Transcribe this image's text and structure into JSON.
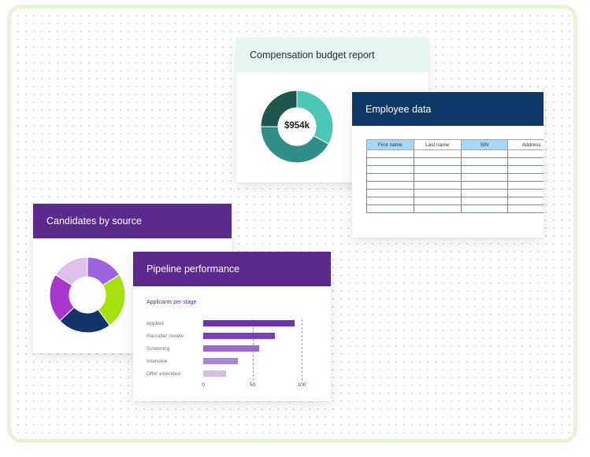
{
  "compensation_card": {
    "title": "Compensation budget report",
    "donut_center": "$954k",
    "segments": [
      {
        "fraction": 0.33,
        "color": "#4cc7b6"
      },
      {
        "fraction": 0.42,
        "color": "#2f8f86"
      },
      {
        "fraction": 0.25,
        "color": "#1f564f"
      }
    ]
  },
  "employee_card": {
    "title": "Employee data",
    "columns": [
      {
        "label": "First name",
        "highlight": true
      },
      {
        "label": "Last name",
        "highlight": false
      },
      {
        "label": "SIN",
        "highlight": true
      },
      {
        "label": "Address",
        "highlight": false
      }
    ],
    "empty_rows": 8
  },
  "candidates_card": {
    "title": "Candidates by source",
    "segments": [
      {
        "fraction": 0.16,
        "color": "#9d62df"
      },
      {
        "fraction": 0.24,
        "color": "#a6e10e"
      },
      {
        "fraction": 0.23,
        "color": "#12336b"
      },
      {
        "fraction": 0.21,
        "color": "#a837cd"
      },
      {
        "fraction": 0.16,
        "color": "#dfc0eb"
      }
    ]
  },
  "pipeline_card": {
    "title": "Pipeline performance",
    "chart_data": {
      "type": "bar",
      "title": "Applicants per stage",
      "categories": [
        "Applied",
        "Recruiter review",
        "Screening",
        "Interview",
        "Offer extended"
      ],
      "values": [
        93,
        73,
        57,
        35,
        23
      ],
      "bar_colors": [
        "#7031b4",
        "#7a3ec0",
        "#9a68d3",
        "#ab85d8",
        "#d3bde9"
      ],
      "xlim": [
        0,
        100
      ],
      "xticks": [
        "0",
        "50",
        "100"
      ],
      "grid": true
    }
  }
}
